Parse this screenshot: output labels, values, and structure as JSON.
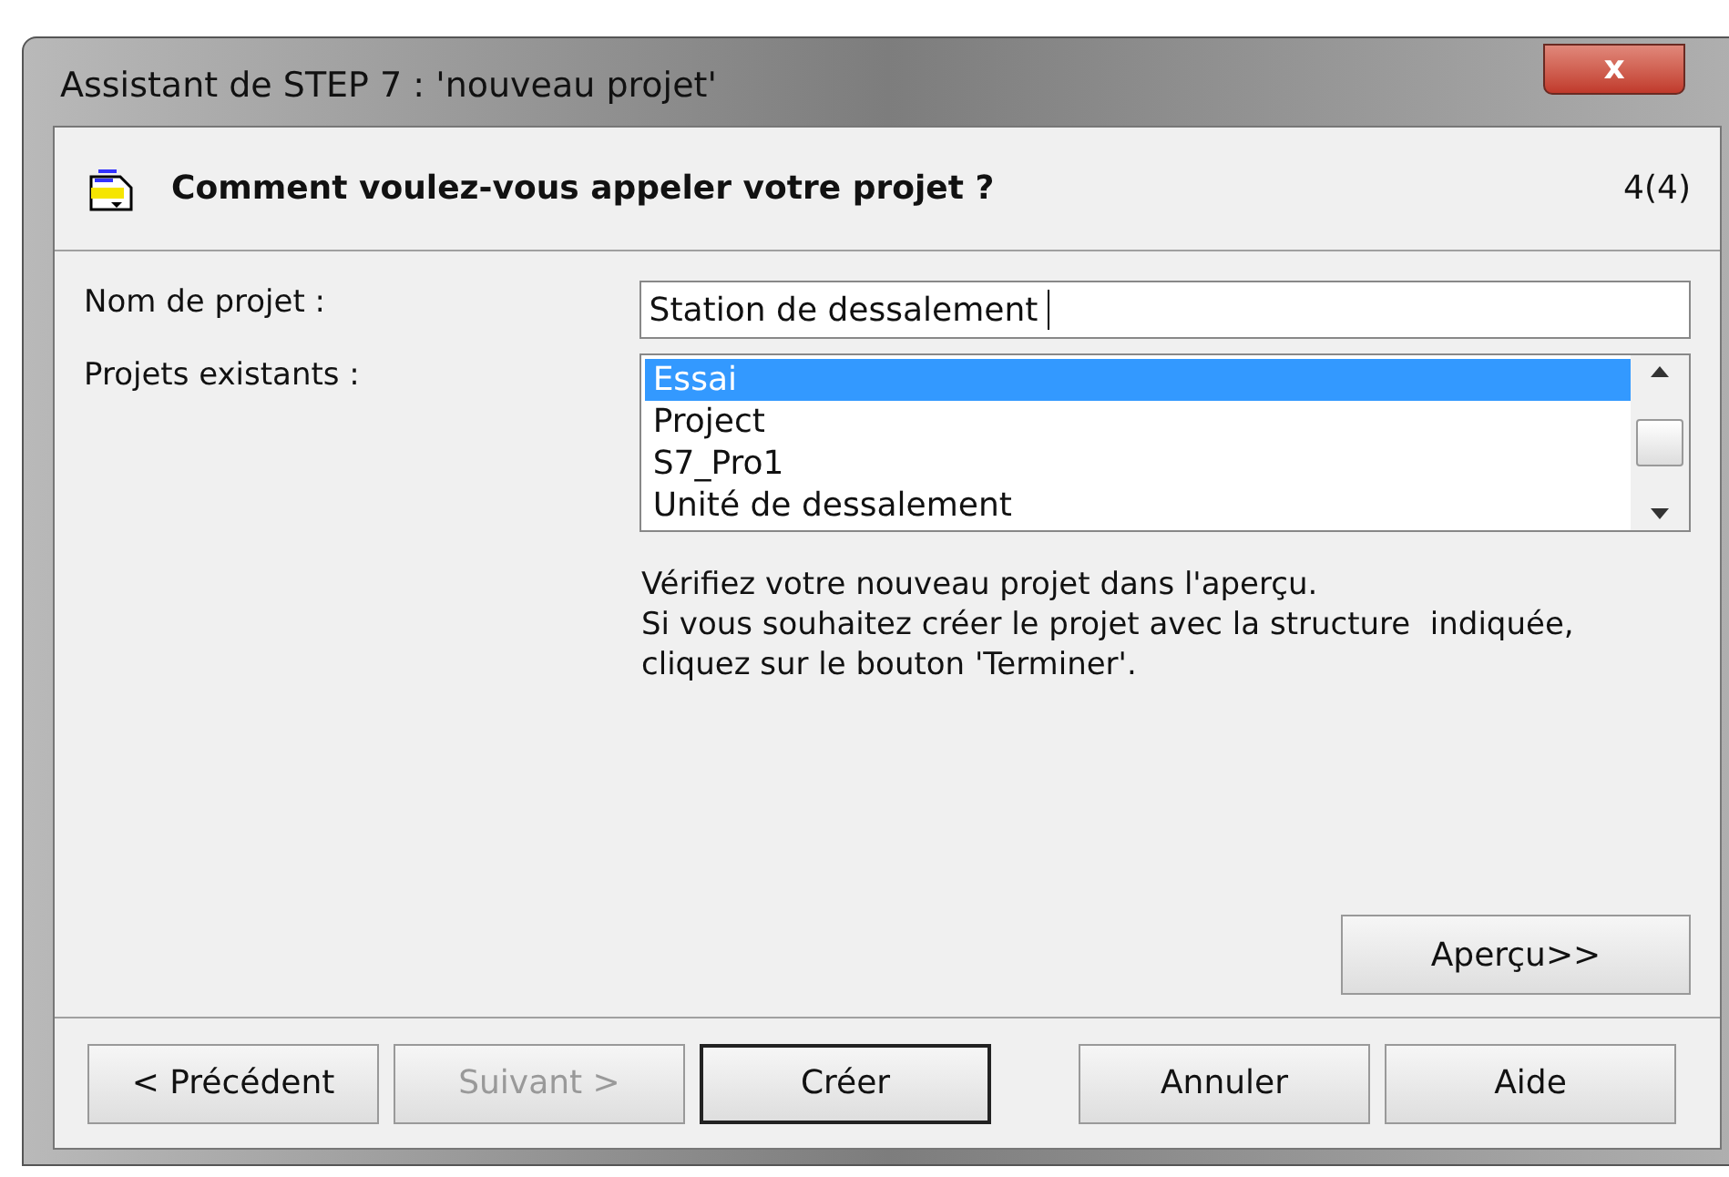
{
  "window": {
    "title": "Assistant de STEP 7 : 'nouveau projet'",
    "close": "x"
  },
  "header": {
    "title": "Comment voulez-vous appeler votre projet ?",
    "step": "4(4)"
  },
  "name_field": {
    "label": "Nom de projet :",
    "value": "Station de dessalement "
  },
  "existing": {
    "label": "Projets existants :",
    "items": [
      {
        "text": "Essai",
        "selected": true
      },
      {
        "text": "Project",
        "selected": false
      },
      {
        "text": "S7_Pro1",
        "selected": false
      },
      {
        "text": "Unité de dessalement",
        "selected": false
      }
    ]
  },
  "info": [
    "Vérifiez votre nouveau projet dans l'aperçu.",
    "Si vous souhaitez créer le projet avec la structure  indiquée,",
    "cliquez sur le bouton 'Terminer'."
  ],
  "preview_button": "Aperçu>>",
  "buttons": [
    {
      "label": "< Précédent",
      "disabled": false,
      "default": false
    },
    {
      "label": "Suivant >",
      "disabled": true,
      "default": false
    },
    {
      "label": "Créer",
      "disabled": false,
      "default": true
    },
    {
      "label": "Annuler",
      "disabled": false,
      "default": false
    },
    {
      "label": "Aide",
      "disabled": false,
      "default": false
    }
  ]
}
